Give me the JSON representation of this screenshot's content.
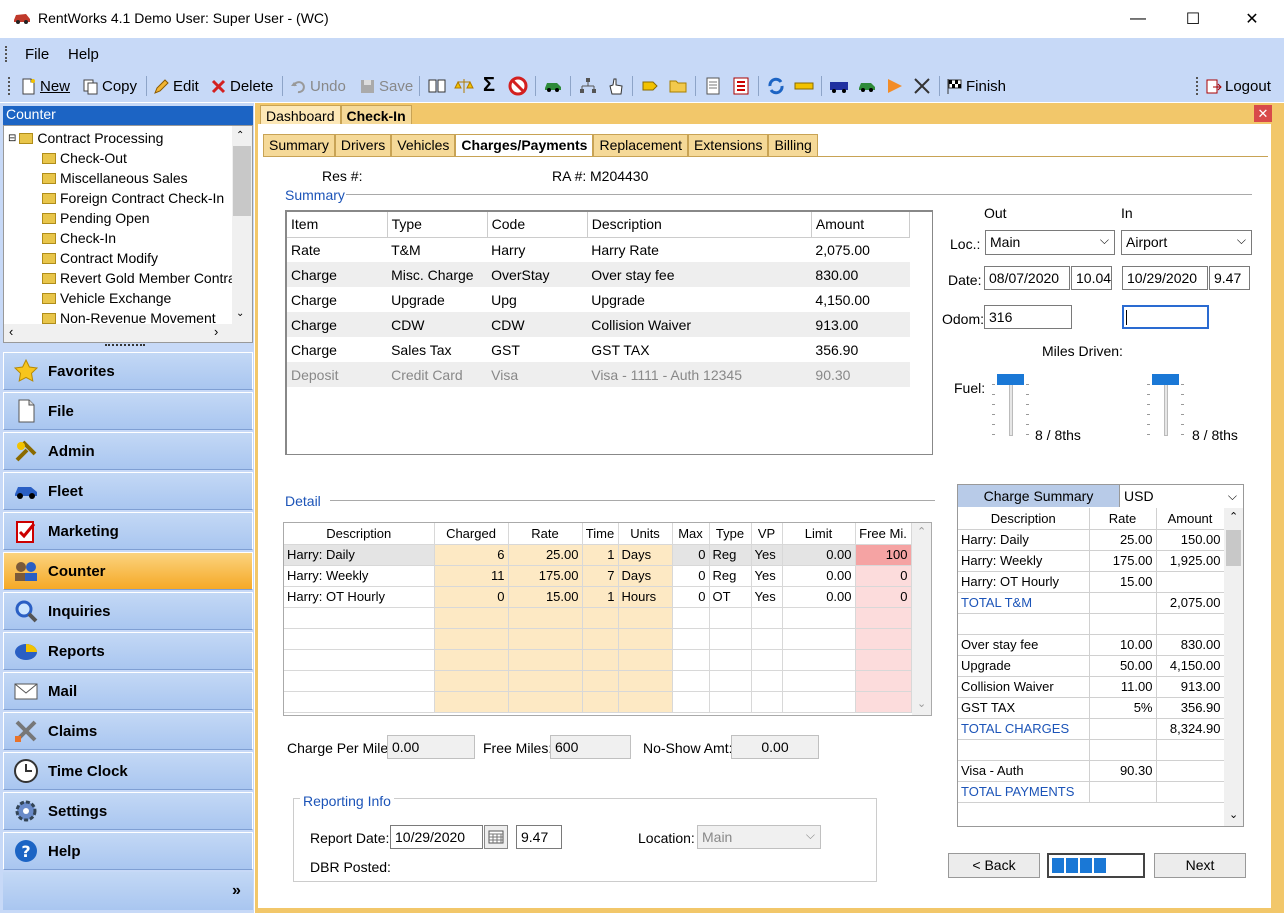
{
  "window": {
    "title": "RentWorks 4.1 Demo  User: Super User - (WC)",
    "minimize": "—",
    "maximize": "☐",
    "close": "✕"
  },
  "menu": {
    "file": "File",
    "help": "Help"
  },
  "toolbar": {
    "new": "New",
    "copy": "Copy",
    "edit": "Edit",
    "delete": "Delete",
    "undo": "Undo",
    "save": "Save",
    "finish": "Finish",
    "logout": "Logout"
  },
  "left": {
    "header": "Counter",
    "tree": {
      "root": "Contract Processing",
      "items": [
        "Check-Out",
        "Miscellaneous Sales",
        "Foreign Contract Check-In",
        "Pending Open",
        "Check-In",
        "Contract Modify",
        "Revert Gold Member Contrac",
        "Vehicle Exchange",
        "Non-Revenue Movement"
      ]
    },
    "nav": [
      "Favorites",
      "File",
      "Admin",
      "Fleet",
      "Marketing",
      "Counter",
      "Inquiries",
      "Reports",
      "Mail",
      "Claims",
      "Time Clock",
      "Settings",
      "Help"
    ],
    "more": "»"
  },
  "tabs": {
    "main": [
      "Dashboard",
      "Check-In"
    ],
    "sub": [
      "Summary",
      "Drivers",
      "Vehicles",
      "Charges/Payments",
      "Replacement",
      "Extensions",
      "Billing"
    ]
  },
  "res": {
    "res_label": "Res #:",
    "res_value": "",
    "ra_label": "RA #:",
    "ra_value": "M204430"
  },
  "summary": {
    "title": "Summary",
    "columns": [
      "Item",
      "Type",
      "Code",
      "Description",
      "Amount"
    ],
    "rows": [
      [
        "Rate",
        "T&M",
        "Harry",
        "Harry Rate",
        "2,075.00"
      ],
      [
        "Charge",
        "Misc. Charge",
        "OverStay",
        "Over stay fee",
        "830.00"
      ],
      [
        "Charge",
        "Upgrade",
        "Upg",
        "Upgrade",
        "4,150.00"
      ],
      [
        "Charge",
        "CDW",
        "CDW",
        "Collision Waiver",
        "913.00"
      ],
      [
        "Charge",
        "Sales Tax",
        "GST",
        "GST TAX",
        "356.90"
      ],
      [
        "Deposit",
        "Credit Card",
        "Visa",
        "Visa - 1111 - Auth 12345",
        "90.30"
      ]
    ]
  },
  "trip": {
    "out_label": "Out",
    "in_label": "In",
    "loc_label": "Loc.:",
    "loc_out": "Main",
    "loc_in": "Airport",
    "date_label": "Date:",
    "date_out": "08/07/2020",
    "time_out": "10.04",
    "date_in": "10/29/2020",
    "time_in": "9.47",
    "odom_label": "Odom:",
    "odom_out": "316",
    "odom_in": "",
    "miles_label": "Miles Driven:",
    "fuel_label": "Fuel:",
    "fuel_out": "8 / 8ths",
    "fuel_in": "8 / 8ths",
    "fuel_out_level": 1.0,
    "fuel_in_level": 1.0
  },
  "detail": {
    "title": "Detail",
    "columns": [
      "Description",
      "Charged",
      "Rate",
      "Time",
      "Units",
      "Max",
      "Type",
      "VP",
      "Limit",
      "Free Mi."
    ],
    "rows": [
      [
        "Harry: Daily",
        "6",
        "25.00",
        "1",
        "Days",
        "0",
        "Reg",
        "Yes",
        "0.00",
        "100"
      ],
      [
        "Harry: Weekly",
        "11",
        "175.00",
        "7",
        "Days",
        "0",
        "Reg",
        "Yes",
        "0.00",
        "0"
      ],
      [
        "Harry: OT Hourly",
        "0",
        "15.00",
        "1",
        "Hours",
        "0",
        "OT",
        "Yes",
        "0.00",
        "0"
      ]
    ]
  },
  "charges_extra": {
    "cpm_label": "Charge Per Mile:",
    "cpm": "0.00",
    "free_label": "Free Miles:",
    "free": "600",
    "noshow_label": "No-Show Amt:",
    "noshow": "0.00"
  },
  "reporting": {
    "title": "Reporting Info",
    "date_label": "Report Date:",
    "date": "10/29/2020",
    "time": "9.47",
    "loc_label": "Location:",
    "loc": "Main",
    "dbr_label": "DBR Posted:"
  },
  "charge_summary": {
    "title": "Charge Summary",
    "currency": "USD",
    "columns": [
      "Description",
      "Rate",
      "Amount"
    ],
    "rows": [
      {
        "d": "Harry: Daily",
        "r": "25.00",
        "a": "150.00",
        "total": false
      },
      {
        "d": "Harry: Weekly",
        "r": "175.00",
        "a": "1,925.00",
        "total": false
      },
      {
        "d": "Harry: OT Hourly",
        "r": "15.00",
        "a": "",
        "total": false
      },
      {
        "d": "TOTAL T&M",
        "r": "",
        "a": "2,075.00",
        "total": true
      },
      {
        "d": "",
        "r": "",
        "a": "",
        "total": false
      },
      {
        "d": "Over stay fee",
        "r": "10.00",
        "a": "830.00",
        "total": false
      },
      {
        "d": "Upgrade",
        "r": "50.00",
        "a": "4,150.00",
        "total": false
      },
      {
        "d": "Collision Waiver",
        "r": "11.00",
        "a": "913.00",
        "total": false
      },
      {
        "d": "GST TAX",
        "r": "5%",
        "a": "356.90",
        "total": false
      },
      {
        "d": "TOTAL CHARGES",
        "r": "",
        "a": "8,324.90",
        "total": true
      },
      {
        "d": "",
        "r": "",
        "a": "",
        "total": false
      },
      {
        "d": "Visa - Auth",
        "r": "90.30",
        "a": "",
        "total": false
      },
      {
        "d": "TOTAL PAYMENTS",
        "r": "",
        "a": "",
        "total": true
      }
    ]
  },
  "wizard": {
    "back": "< Back",
    "next": "Next",
    "progress_steps": 4
  }
}
